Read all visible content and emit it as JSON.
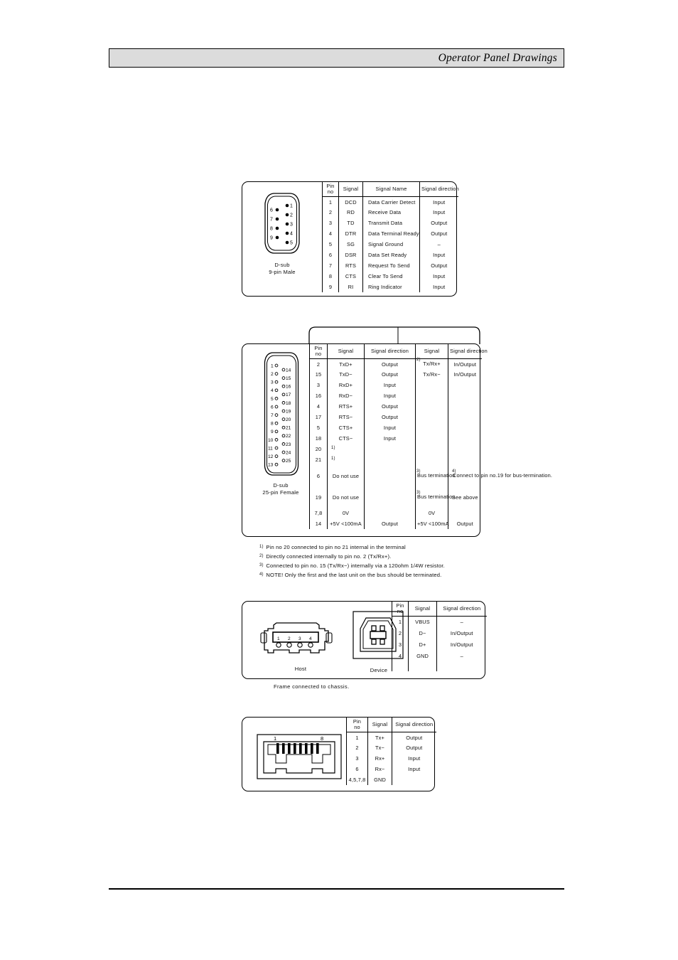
{
  "header": {
    "title": "Operator Panel Drawings"
  },
  "dsub9": {
    "connector": {
      "caption_line1": "D-sub",
      "caption_line2": "9-pin Male",
      "left_pins": [
        "6",
        "7",
        "8",
        "9"
      ],
      "right_pins": [
        "1",
        "2",
        "3",
        "4",
        "5"
      ]
    },
    "columns": [
      "Pin\nno",
      "Signal",
      "Signal Name",
      "Signal direction"
    ],
    "col_pin": "Pin",
    "col_no": "no",
    "col_signal": "Signal",
    "col_signal_name": "Signal Name",
    "col_signal_direction": "Signal direction",
    "rows": [
      {
        "pin": "1",
        "signal": "DCD",
        "name": "Data Carrier Detect",
        "direction": "Input"
      },
      {
        "pin": "2",
        "signal": "RD",
        "name": "Receive Data",
        "direction": "Input"
      },
      {
        "pin": "3",
        "signal": "TD",
        "name": "Transmit Data",
        "direction": "Output"
      },
      {
        "pin": "4",
        "signal": "DTR",
        "name": "Data Terminal Ready",
        "direction": "Output"
      },
      {
        "pin": "5",
        "signal": "SG",
        "name": "Signal Ground",
        "direction": "–"
      },
      {
        "pin": "6",
        "signal": "DSR",
        "name": "Data Set Ready",
        "direction": "Input"
      },
      {
        "pin": "7",
        "signal": "RTS",
        "name": "Request To Send",
        "direction": "Output"
      },
      {
        "pin": "8",
        "signal": "CTS",
        "name": "Clear To Send",
        "direction": "Input"
      },
      {
        "pin": "9",
        "signal": "RI",
        "name": "Ring Indicator",
        "direction": "Input"
      }
    ]
  },
  "dsub25": {
    "connector": {
      "caption_line1": "D-sub",
      "caption_line2": "25-pin Female",
      "left_pins": [
        "1",
        "2",
        "3",
        "4",
        "5",
        "6",
        "7",
        "8",
        "9",
        "10",
        "11",
        "12",
        "13"
      ],
      "right_pins": [
        "14",
        "15",
        "16",
        "17",
        "18",
        "19",
        "20",
        "21",
        "22",
        "23",
        "24",
        "25"
      ]
    },
    "group_header_left": "",
    "group_header_right": "",
    "col_pin": "Pin",
    "col_no": "no",
    "col_signal_a": "Signal",
    "col_direction_a": "Signal direction",
    "col_signal_b": "Signal",
    "col_direction_b": "Signal direction",
    "rows": [
      {
        "pin": "2",
        "signal_a": "TxD+",
        "dir_a": "Output",
        "signal_b": "Tx/Rx+",
        "sup_b": "2)",
        "dir_b": "In/Output"
      },
      {
        "pin": "15",
        "signal_a": "TxD−",
        "dir_a": "Output",
        "signal_b": "Tx/Rx−",
        "sup_b": "",
        "dir_b": "In/Output"
      },
      {
        "pin": "3",
        "signal_a": "RxD+",
        "dir_a": "Input",
        "signal_b": "",
        "sup_b": "",
        "dir_b": ""
      },
      {
        "pin": "16",
        "signal_a": "RxD−",
        "dir_a": "Input",
        "signal_b": "",
        "sup_b": "",
        "dir_b": ""
      },
      {
        "pin": "4",
        "signal_a": "RTS+",
        "dir_a": "Output",
        "signal_b": "",
        "sup_b": "",
        "dir_b": ""
      },
      {
        "pin": "17",
        "signal_a": "RTS−",
        "dir_a": "Output",
        "signal_b": "",
        "sup_b": "",
        "dir_b": ""
      },
      {
        "pin": "5",
        "signal_a": "CTS+",
        "dir_a": "Input",
        "signal_b": "",
        "sup_b": "",
        "dir_b": ""
      },
      {
        "pin": "18",
        "signal_a": "CTS−",
        "dir_a": "Input",
        "signal_b": "",
        "sup_b": "",
        "dir_b": ""
      },
      {
        "pin": "20",
        "signal_a": "",
        "sup_a": "1)",
        "dir_a": "",
        "signal_b": "",
        "sup_b": "",
        "dir_b": ""
      },
      {
        "pin": "21",
        "signal_a": "",
        "sup_a": "1)",
        "dir_a": "",
        "signal_b": "",
        "sup_b": "",
        "dir_b": ""
      },
      {
        "pin": "6",
        "signal_a": "Do not use",
        "dir_a": "",
        "signal_b": "Bus termination",
        "sup_b": "3)",
        "dir_b": "Connect to pin no.19 for bus-termination.",
        "sup_dir_b": "4)"
      },
      {
        "pin": "19",
        "signal_a": "Do not use",
        "dir_a": "",
        "signal_b": "Bus termination",
        "sup_b": "3)",
        "dir_b": "See above"
      },
      {
        "pin": "7,8",
        "signal_a": "0V",
        "dir_a": "",
        "signal_b": "0V",
        "sup_b": "",
        "dir_b": ""
      },
      {
        "pin": "14",
        "signal_a": "+5V <100mA",
        "dir_a": "Output",
        "signal_b": "+5V <100mA",
        "sup_b": "",
        "dir_b": "Output"
      }
    ],
    "notes": [
      {
        "marker": "1)",
        "text": "Pin no 20 connected to pin no 21 internal in the terminal"
      },
      {
        "marker": "2)",
        "text": "Directly connected internally to pin no. 2 (Tx/Rx+)."
      },
      {
        "marker": "3)",
        "text": "Connected to pin no. 15 (Tx/Rx−) internally via a 120ohm 1/4W resistor."
      },
      {
        "marker": "4)",
        "text": "NOTE! Only the first and the last unit on the bus should be terminated."
      }
    ]
  },
  "usb": {
    "host_label": "Host",
    "device_label": "Device",
    "host_pin_numbers": [
      "1",
      "2",
      "3",
      "4"
    ],
    "col_pin": "Pin",
    "col_no": "no",
    "col_signal": "Signal",
    "col_signal_direction": "Signal direction",
    "rows": [
      {
        "pin": "1",
        "signal": "VBUS",
        "direction": "–"
      },
      {
        "pin": "2",
        "signal": "D−",
        "direction": "In/Output"
      },
      {
        "pin": "3",
        "signal": "D+",
        "direction": "In/Output"
      },
      {
        "pin": "4",
        "signal": "GND",
        "direction": "–"
      }
    ],
    "frame_note": "Frame connected to chassis."
  },
  "ethernet": {
    "connector": {
      "left_label": "1",
      "right_label": "8"
    },
    "col_pin": "Pin",
    "col_no": "no",
    "col_signal": "Signal",
    "col_signal_direction": "Signal direction",
    "rows": [
      {
        "pin": "1",
        "signal": "Tx+",
        "direction": "Output"
      },
      {
        "pin": "2",
        "signal": "Tx−",
        "direction": "Output"
      },
      {
        "pin": "3",
        "signal": "Rx+",
        "direction": "Input"
      },
      {
        "pin": "6",
        "signal": "Rx−",
        "direction": "Input"
      },
      {
        "pin": "4,5,7,8",
        "signal": "GND",
        "direction": ""
      }
    ]
  }
}
